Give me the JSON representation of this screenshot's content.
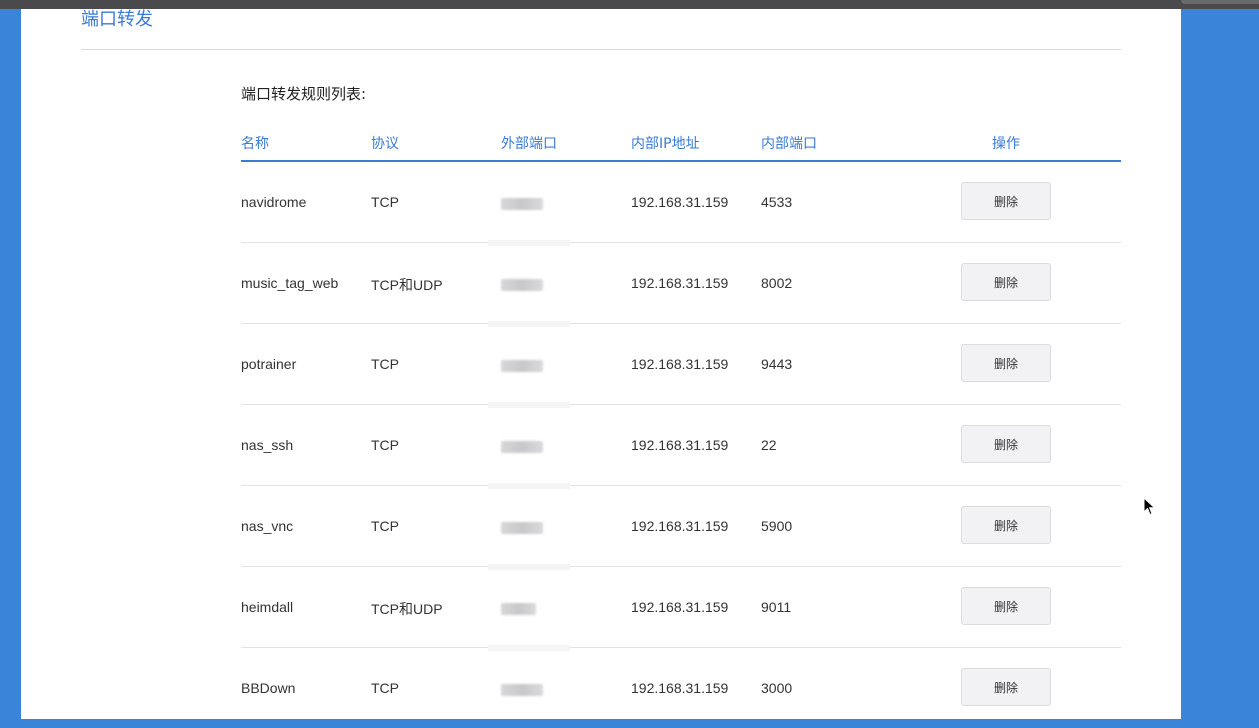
{
  "page": {
    "title": "端口转发",
    "section_label": "端口转发规则列表:"
  },
  "table": {
    "headers": {
      "name": "名称",
      "protocol": "协议",
      "external_port": "外部端口",
      "internal_ip": "内部IP地址",
      "internal_port": "内部端口",
      "actions": "操作"
    },
    "rows": [
      {
        "name": "navidrome",
        "protocol": "TCP",
        "external_port": "",
        "internal_ip": "192.168.31.159",
        "internal_port": "4533",
        "action_label": "删除"
      },
      {
        "name": "music_tag_web",
        "protocol": "TCP和UDP",
        "external_port": "",
        "internal_ip": "192.168.31.159",
        "internal_port": "8002",
        "action_label": "删除"
      },
      {
        "name": "potrainer",
        "protocol": "TCP",
        "external_port": "",
        "internal_ip": "192.168.31.159",
        "internal_port": "9443",
        "action_label": "删除"
      },
      {
        "name": "nas_ssh",
        "protocol": "TCP",
        "external_port": "",
        "internal_ip": "192.168.31.159",
        "internal_port": "22",
        "action_label": "删除"
      },
      {
        "name": "nas_vnc",
        "protocol": "TCP",
        "external_port": "",
        "internal_ip": "192.168.31.159",
        "internal_port": "5900",
        "action_label": "删除"
      },
      {
        "name": "heimdall",
        "protocol": "TCP和UDP",
        "external_port": "",
        "internal_ip": "192.168.31.159",
        "internal_port": "9011",
        "action_label": "删除"
      },
      {
        "name": "BBDown",
        "protocol": "TCP",
        "external_port": "",
        "internal_ip": "192.168.31.159",
        "internal_port": "3000",
        "action_label": "删除"
      }
    ]
  },
  "colors": {
    "accent": "#3a7bd5",
    "background": "#3a84d9"
  },
  "icons": {
    "cursor": "mouse-pointer-icon"
  }
}
